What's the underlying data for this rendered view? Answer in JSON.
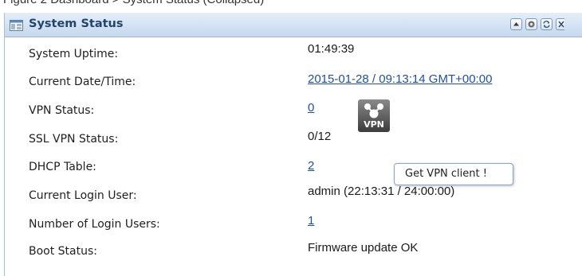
{
  "window": {
    "top_strip_text": "Figure 2 Dashboard > System Status (Collapsed)"
  },
  "panel": {
    "title": "System Status",
    "icons": [
      "panel-icon",
      "collapse-icon",
      "settings-icon",
      "refresh-icon",
      "close-icon"
    ]
  },
  "status": {
    "rows": [
      {
        "label": "System Uptime:",
        "value": "01:49:39",
        "link": false
      },
      {
        "label": "Current Date/Time:",
        "value": "2015-01-28 / 09:13:14 GMT+00:00",
        "link": true
      },
      {
        "label": "VPN Status:",
        "value": "0",
        "link": true
      },
      {
        "label": "SSL VPN Status:",
        "value": "0/12",
        "link": false
      },
      {
        "label": "DHCP Table:",
        "value": "2",
        "link": true
      },
      {
        "label": "Current Login User:",
        "value": "admin (22:13:31 / 24:00:00)",
        "link": false
      },
      {
        "label": "Number of Login Users:",
        "value": "1",
        "link": true
      },
      {
        "label": "Boot Status:",
        "value": "Firmware update OK",
        "link": false
      }
    ]
  },
  "vpn_client": {
    "icon_text": "VPN",
    "tooltip": "Get VPN client !"
  },
  "colors": {
    "header_bg": "#c5d8ee",
    "title": "#21466e",
    "link": "#1f4fa6"
  }
}
